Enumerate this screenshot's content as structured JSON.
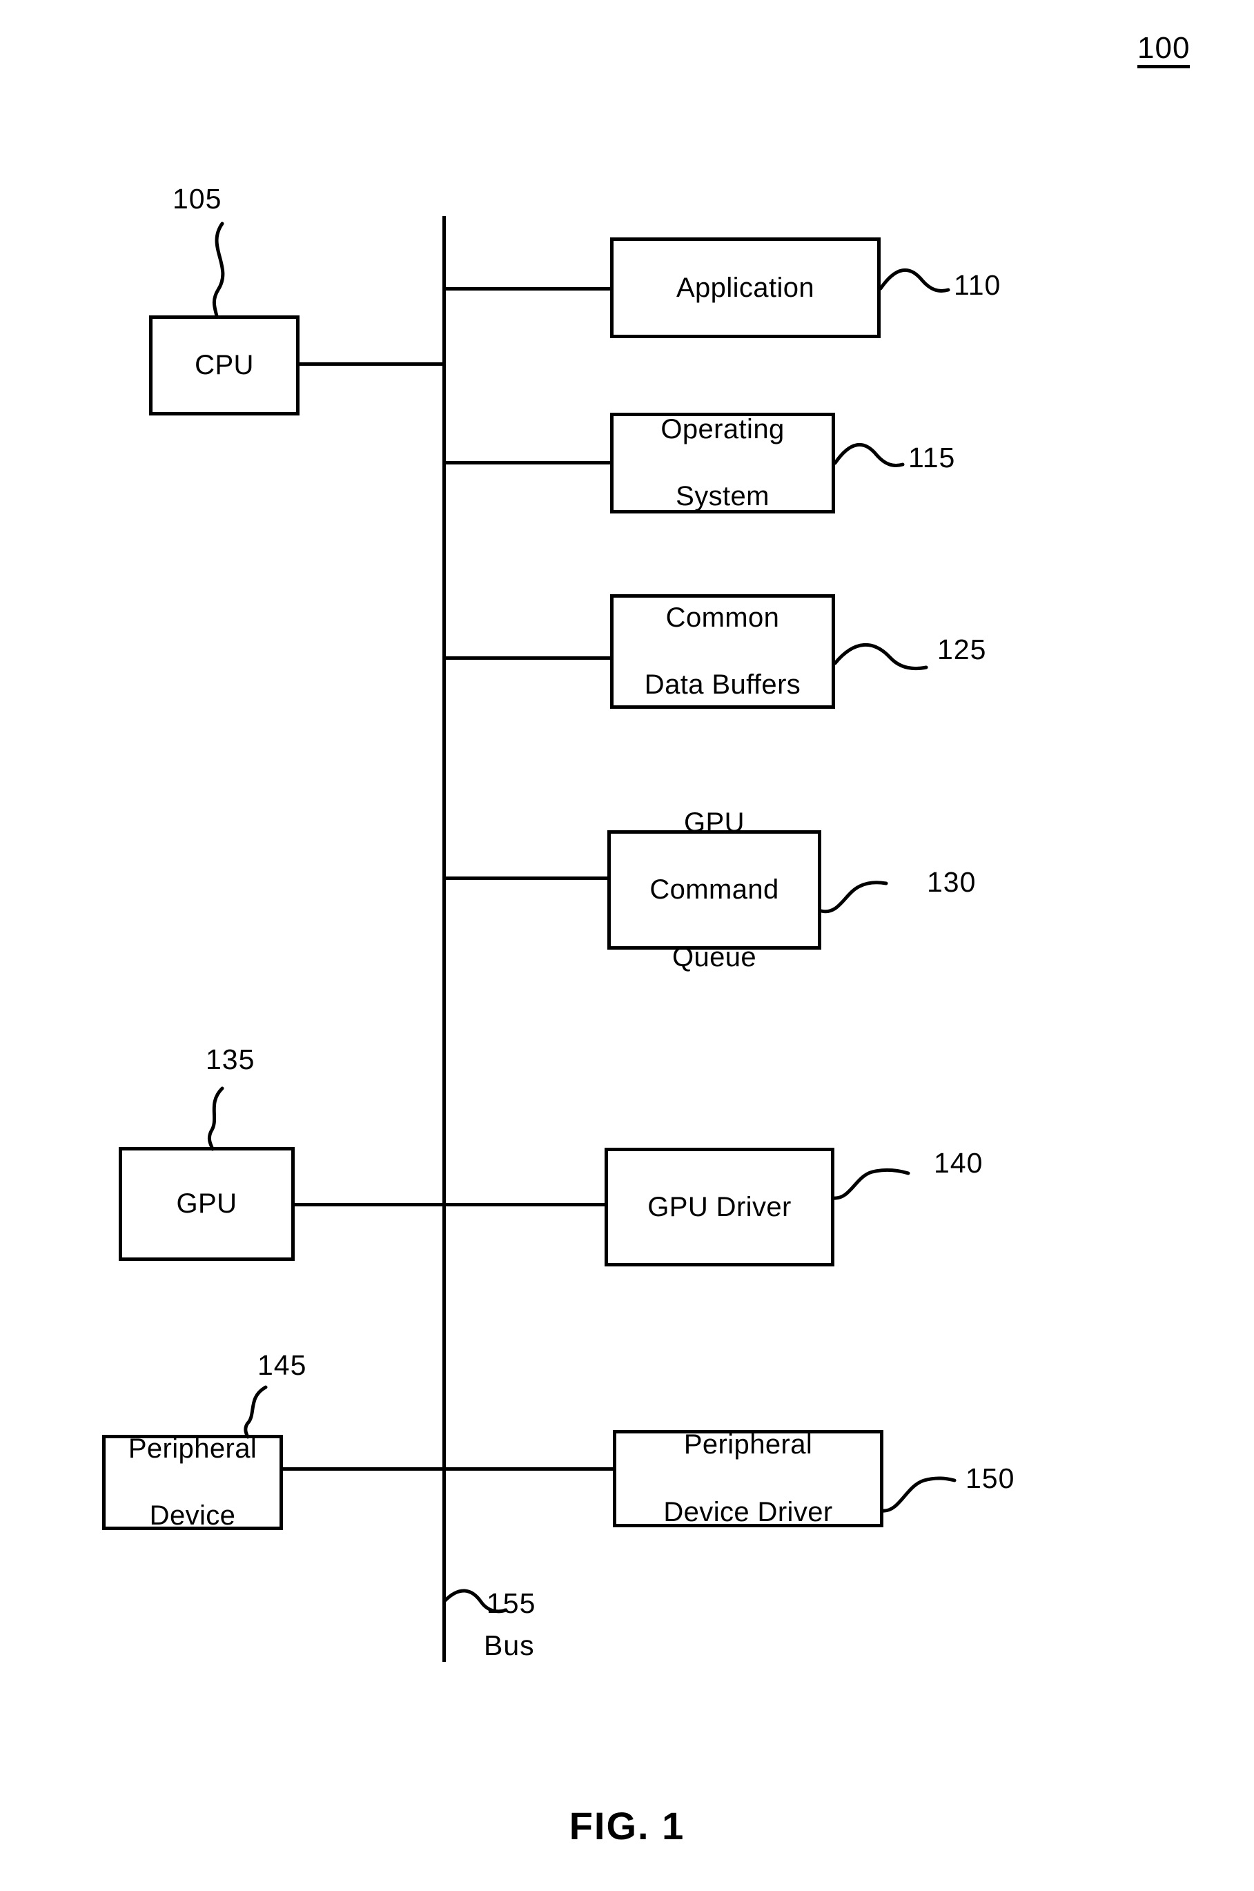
{
  "figure": {
    "diagram_number": "100",
    "caption": "FIG. 1"
  },
  "nodes": [
    {
      "id": "cpu",
      "label": "CPU",
      "ref": "105"
    },
    {
      "id": "application",
      "label": "Application",
      "ref": "110"
    },
    {
      "id": "operating_system",
      "label_line1": "Operating",
      "label_line2": "System",
      "ref": "115"
    },
    {
      "id": "common_data_buffers",
      "label_line1": "Common",
      "label_line2": "Data Buffers",
      "ref": "125"
    },
    {
      "id": "gpu_command_queue",
      "label_line1": "GPU",
      "label_line2": "Command",
      "label_line3": "Queue",
      "ref": "130"
    },
    {
      "id": "gpu",
      "label": "GPU",
      "ref": "135"
    },
    {
      "id": "gpu_driver",
      "label": "GPU Driver",
      "ref": "140"
    },
    {
      "id": "peripheral_device",
      "label_line1": "Peripheral",
      "label_line2": "Device",
      "ref": "145"
    },
    {
      "id": "peripheral_driver",
      "label_line1": "Peripheral",
      "label_line2": "Device Driver",
      "ref": "150"
    }
  ],
  "bus": {
    "ref": "155",
    "label": "Bus"
  },
  "colors": {
    "stroke": "#000000",
    "background": "#ffffff"
  }
}
